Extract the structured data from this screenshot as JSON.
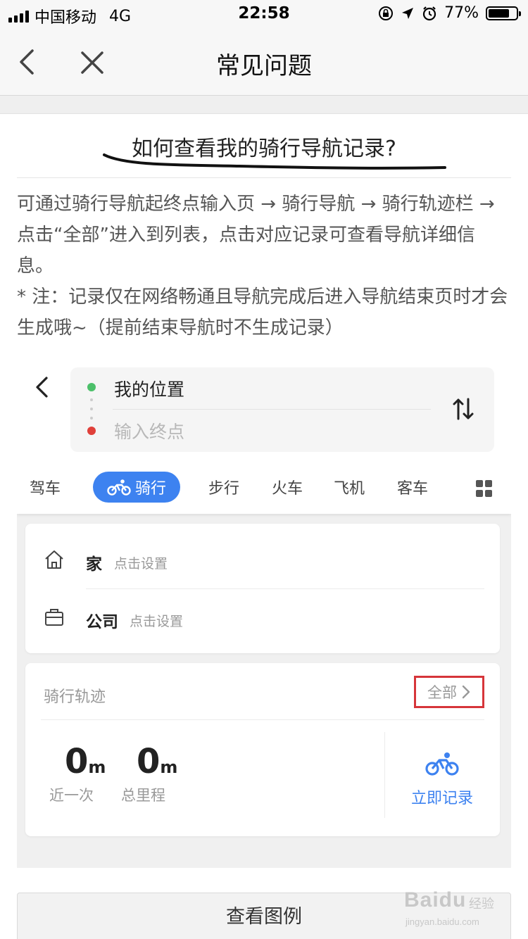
{
  "status_bar": {
    "carrier": "中国移动",
    "network": "4G",
    "time": "22:58",
    "battery": "77%",
    "battery_level": 0.77
  },
  "nav": {
    "title": "常见问题"
  },
  "article": {
    "title": "如何查看我的骑行导航记录?",
    "paragraph1": "可通过骑行导航起终点输入页 → 骑行导航 → 骑行轨迹栏 → 点击“全部”进入到列表，点击对应记录可查看导航详细信息。",
    "paragraph2": "* 注：记录仅在网络畅通且导航完成后进入导航结束页时才会生成哦~（提前结束导航时不生成记录）"
  },
  "embed": {
    "route": {
      "origin": "我的位置",
      "destination_placeholder": "输入终点"
    },
    "modes": [
      "驾车",
      "骑行",
      "步行",
      "火车",
      "飞机",
      "客车"
    ],
    "active_mode": "骑行",
    "places": {
      "home_label": "家",
      "home_hint": "点击设置",
      "work_label": "公司",
      "work_hint": "点击设置"
    },
    "track": {
      "title": "骑行轨迹",
      "all_label": "全部",
      "last_value": "0",
      "last_unit": "m",
      "last_label": "近一次",
      "total_value": "0",
      "total_unit": "m",
      "total_label": "总里程",
      "record_now": "立即记录"
    },
    "accent_color": "#3d82f0",
    "highlight_color": "#d6353a"
  },
  "legend_button": "查看图例",
  "watermark": {
    "brand": "Baidu",
    "tag": "经验",
    "url": "jingyan.baidu.com"
  }
}
